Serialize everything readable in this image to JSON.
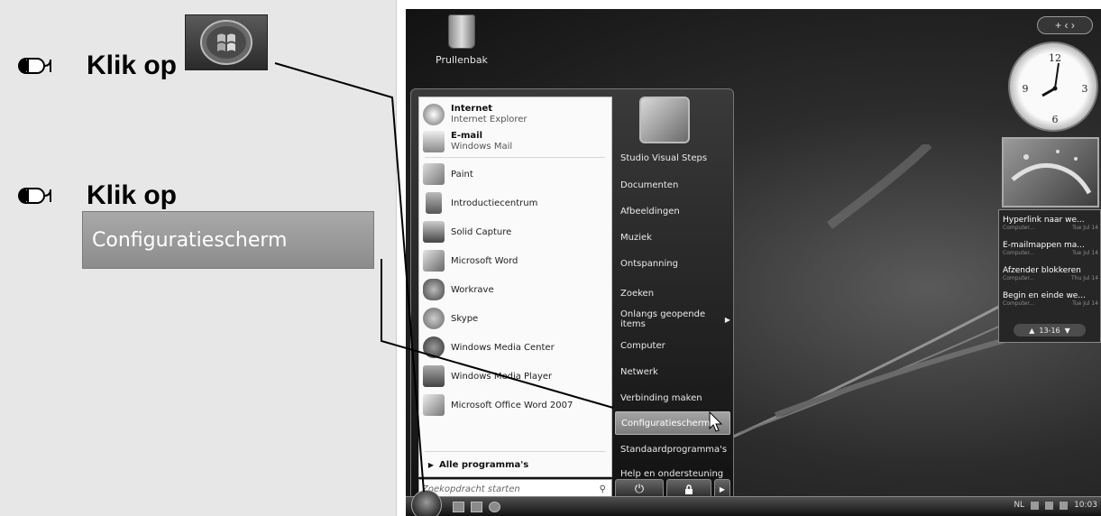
{
  "instructions": {
    "step1_text": "Klik op",
    "step2_text": "Klik op",
    "step2_button_label": "Configuratiescherm"
  },
  "desktop": {
    "recycle_bin_label": "Prullenbak"
  },
  "start_menu": {
    "programs": [
      {
        "title": "Internet",
        "subtitle": "Internet Explorer"
      },
      {
        "title": "E-mail",
        "subtitle": "Windows Mail"
      },
      {
        "title": "Paint"
      },
      {
        "title": "Introductiecentrum"
      },
      {
        "title": "Solid Capture"
      },
      {
        "title": "Microsoft Word"
      },
      {
        "title": "Workrave"
      },
      {
        "title": "Skype"
      },
      {
        "title": "Windows Media Center"
      },
      {
        "title": "Windows Media Player"
      },
      {
        "title": "Microsoft Office Word 2007"
      }
    ],
    "all_programs": "Alle programma's",
    "search_placeholder": "Zoekopdracht starten",
    "places": [
      {
        "label": "Studio Visual Steps"
      },
      {
        "label": "Documenten"
      },
      {
        "label": "Afbeeldingen"
      },
      {
        "label": "Muziek"
      },
      {
        "label": "Ontspanning"
      },
      {
        "label": "Zoeken"
      },
      {
        "label": "Onlangs geopende items",
        "has_submenu": true
      },
      {
        "label": "Computer"
      },
      {
        "label": "Netwerk"
      },
      {
        "label": "Verbinding maken"
      },
      {
        "label": "Configuratiescherm",
        "highlighted": true
      },
      {
        "label": "Standaardprogramma's"
      },
      {
        "label": "Help en ondersteuning"
      }
    ]
  },
  "sidebar": {
    "controls": "+ ‹ ›",
    "feeds": [
      {
        "title": "Hyperlink naar we...",
        "source": "Computer...",
        "date": "Tue Jul 14"
      },
      {
        "title": "E-mailmappen ma...",
        "source": "Computer...",
        "date": "Tue Jul 14"
      },
      {
        "title": "Afzender blokkeren",
        "source": "Computer...",
        "date": "Thu Jul 14"
      },
      {
        "title": "Begin en einde we...",
        "source": "Computer...",
        "date": "Tue Jul 14"
      }
    ],
    "feed_pager": "13-16"
  },
  "taskbar": {
    "language": "NL",
    "clock": "10:03"
  },
  "colors": {
    "panel_bg": "#e7e7e7",
    "highlight": "#8c8c8c"
  }
}
